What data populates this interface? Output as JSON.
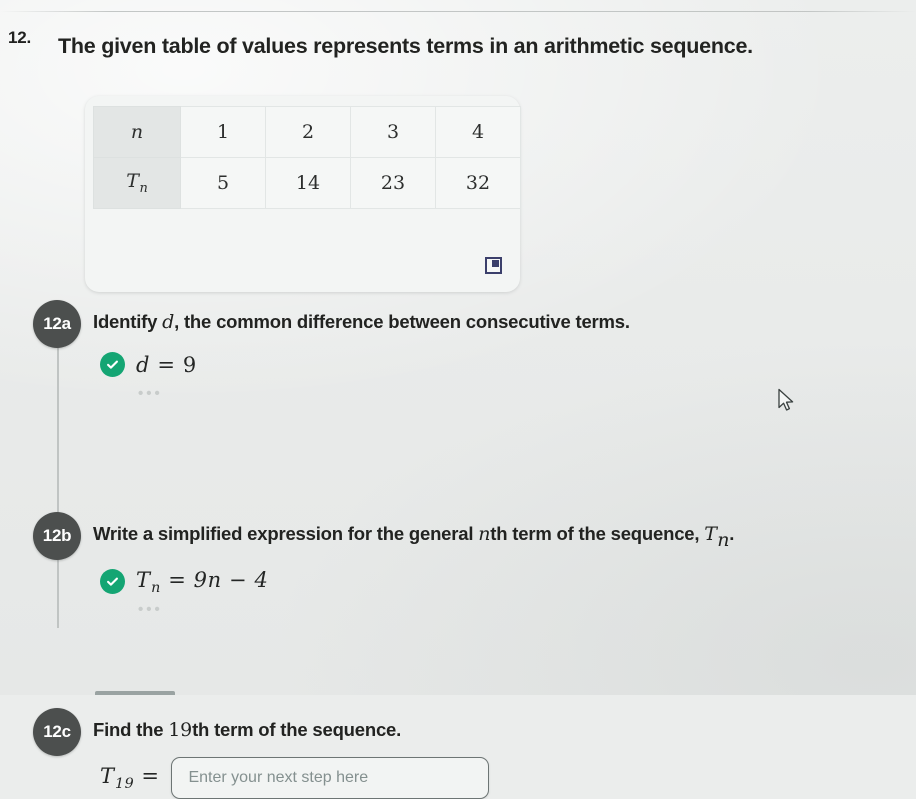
{
  "question": {
    "number": "12.",
    "title": "The given table of values represents terms in an arithmetic sequence."
  },
  "table_card": {
    "expand_icon": "expand-icon",
    "rows": [
      {
        "header": "n",
        "header_sub": "",
        "cells": [
          "1",
          "2",
          "3",
          "4"
        ]
      },
      {
        "header": "T",
        "header_sub": "n",
        "cells": [
          "5",
          "14",
          "23",
          "32"
        ]
      }
    ]
  },
  "steps": [
    {
      "badge": "12a",
      "prompt_before": "Identify ",
      "prompt_math": "d",
      "prompt_after": ", the common difference between consecutive terms.",
      "status_icon": "check-icon",
      "answer_lhs": "d",
      "answer_eq": "=",
      "answer_rhs": "9",
      "ellipsis": "•••"
    },
    {
      "badge": "12b",
      "prompt_before": "Write a simplified expression for the general ",
      "prompt_math": "n",
      "prompt_after": "th term of the sequence, ",
      "prompt_math2": "T",
      "prompt_math2_sub": "n",
      "prompt_end": ".",
      "status_icon": "check-icon",
      "answer_lhs": "T",
      "answer_lhs_sub": "n",
      "answer_eq": "=",
      "answer_rhs": "9n − 4",
      "ellipsis": "•••"
    },
    {
      "badge": "12c",
      "prompt_before": "Find the ",
      "prompt_math": "19",
      "prompt_after": "th term of the sequence.",
      "answer_lhs": "T",
      "answer_lhs_sub": "19",
      "answer_eq": "=",
      "input_value": "",
      "input_placeholder": "Enter your next step here"
    }
  ],
  "colors": {
    "background": "#ebedec",
    "badge": "#4c4f4e",
    "check": "#14a573",
    "expand_icon": "#3b3f6b",
    "input_border": "#6d7574"
  }
}
